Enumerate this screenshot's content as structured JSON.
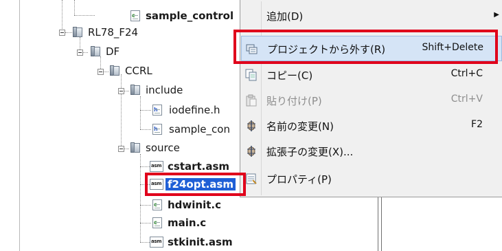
{
  "tree": {
    "items": [
      {
        "label": "sample_control",
        "icon": "c-file-icon",
        "bold": true
      },
      {
        "label": "RL78_F24",
        "icon": "folder-icon",
        "bold": false
      },
      {
        "label": "DF",
        "icon": "folder-icon",
        "bold": false
      },
      {
        "label": "CCRL",
        "icon": "folder-icon",
        "bold": false
      },
      {
        "label": "include",
        "icon": "folder-icon",
        "bold": false
      },
      {
        "label": "iodefine.h",
        "icon": "h-file-icon",
        "bold": false
      },
      {
        "label": "sample_con",
        "icon": "h-file-icon",
        "bold": false
      },
      {
        "label": "source",
        "icon": "folder-icon",
        "bold": false
      },
      {
        "label": "cstart.asm",
        "icon": "asm-file-icon",
        "bold": true
      },
      {
        "label": "f24opt.asm",
        "icon": "asm-file-icon",
        "bold": true,
        "selected": true
      },
      {
        "label": "hdwinit.c",
        "icon": "c-file-icon",
        "bold": true
      },
      {
        "label": "main.c",
        "icon": "c-file-icon",
        "bold": true
      },
      {
        "label": "stkinit.asm",
        "icon": "asm-file-icon",
        "bold": true
      }
    ],
    "icon_tags": {
      "c": "c",
      "h": "h",
      "asm": "asm"
    }
  },
  "context_menu": {
    "items": [
      {
        "label": "追加(D)",
        "shortcut": "",
        "submenu_arrow": "▶",
        "icon": "none"
      },
      {
        "label": "プロジェクトから外す(R)",
        "shortcut": "Shift+Delete",
        "icon": "remove-from-project-icon",
        "highlighted": true
      },
      {
        "label": "コピー(C)",
        "shortcut": "Ctrl+C",
        "icon": "copy-icon"
      },
      {
        "label": "貼り付け(P)",
        "shortcut": "Ctrl+V",
        "icon": "paste-icon",
        "disabled": true
      },
      {
        "label": "名前の変更(N)",
        "shortcut": "F2",
        "icon": "rename-icon"
      },
      {
        "label": "拡張子の変更(X)...",
        "shortcut": "",
        "icon": "change-extension-icon"
      },
      {
        "label": "プロパティ(P)",
        "shortcut": "",
        "icon": "properties-icon"
      }
    ]
  },
  "colors": {
    "highlight_box": "#e0001b",
    "selection": "#1f5fd6",
    "menu_bg": "#f0f0f0",
    "menu_hover": "#d5e4f6"
  }
}
